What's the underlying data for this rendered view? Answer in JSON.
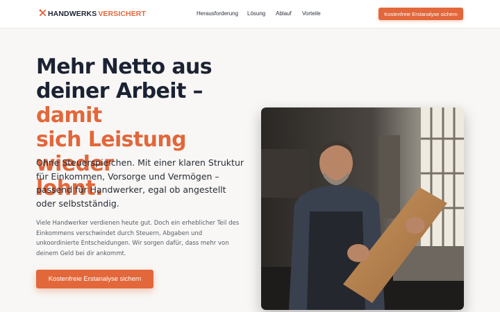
{
  "header": {
    "logo_part1": "HANDWERKS",
    "logo_part2": "VERSICHERT",
    "logo_icon": "tools-icon",
    "nav": [
      "Herausforderung",
      "Lösung",
      "Ablauf",
      "Vorteile"
    ],
    "cta": "Kostenfreie Erstanalyse sichern"
  },
  "hero": {
    "headline_line1": "Mehr Netto aus",
    "headline_line2_dark": "deiner Arbeit – ",
    "headline_line2_accent": "damit",
    "headline_line3": "sich Leistung wieder",
    "headline_line4": "lohnt.",
    "lead": "Ohne Steuerspielchen. Mit einer klaren Struktur für Einkommen, Vorsorge und Vermögen – passend für Handwerker, egal ob angestellt oder selbstständig.",
    "body": "Viele Handwerker verdienen heute gut. Doch ein erheblicher Teil des Einkommens verschwindet durch Steuern, Abgaben und unkoordinierte Entscheidungen. Wir sorgen dafür, dass mehr von deinem Geld bei dir ankommt.",
    "cta": "Kostenfreie Erstanalyse sichern"
  },
  "colors": {
    "accent": "#e2673a",
    "heading": "#1b2333",
    "background": "#f8f7f5"
  }
}
